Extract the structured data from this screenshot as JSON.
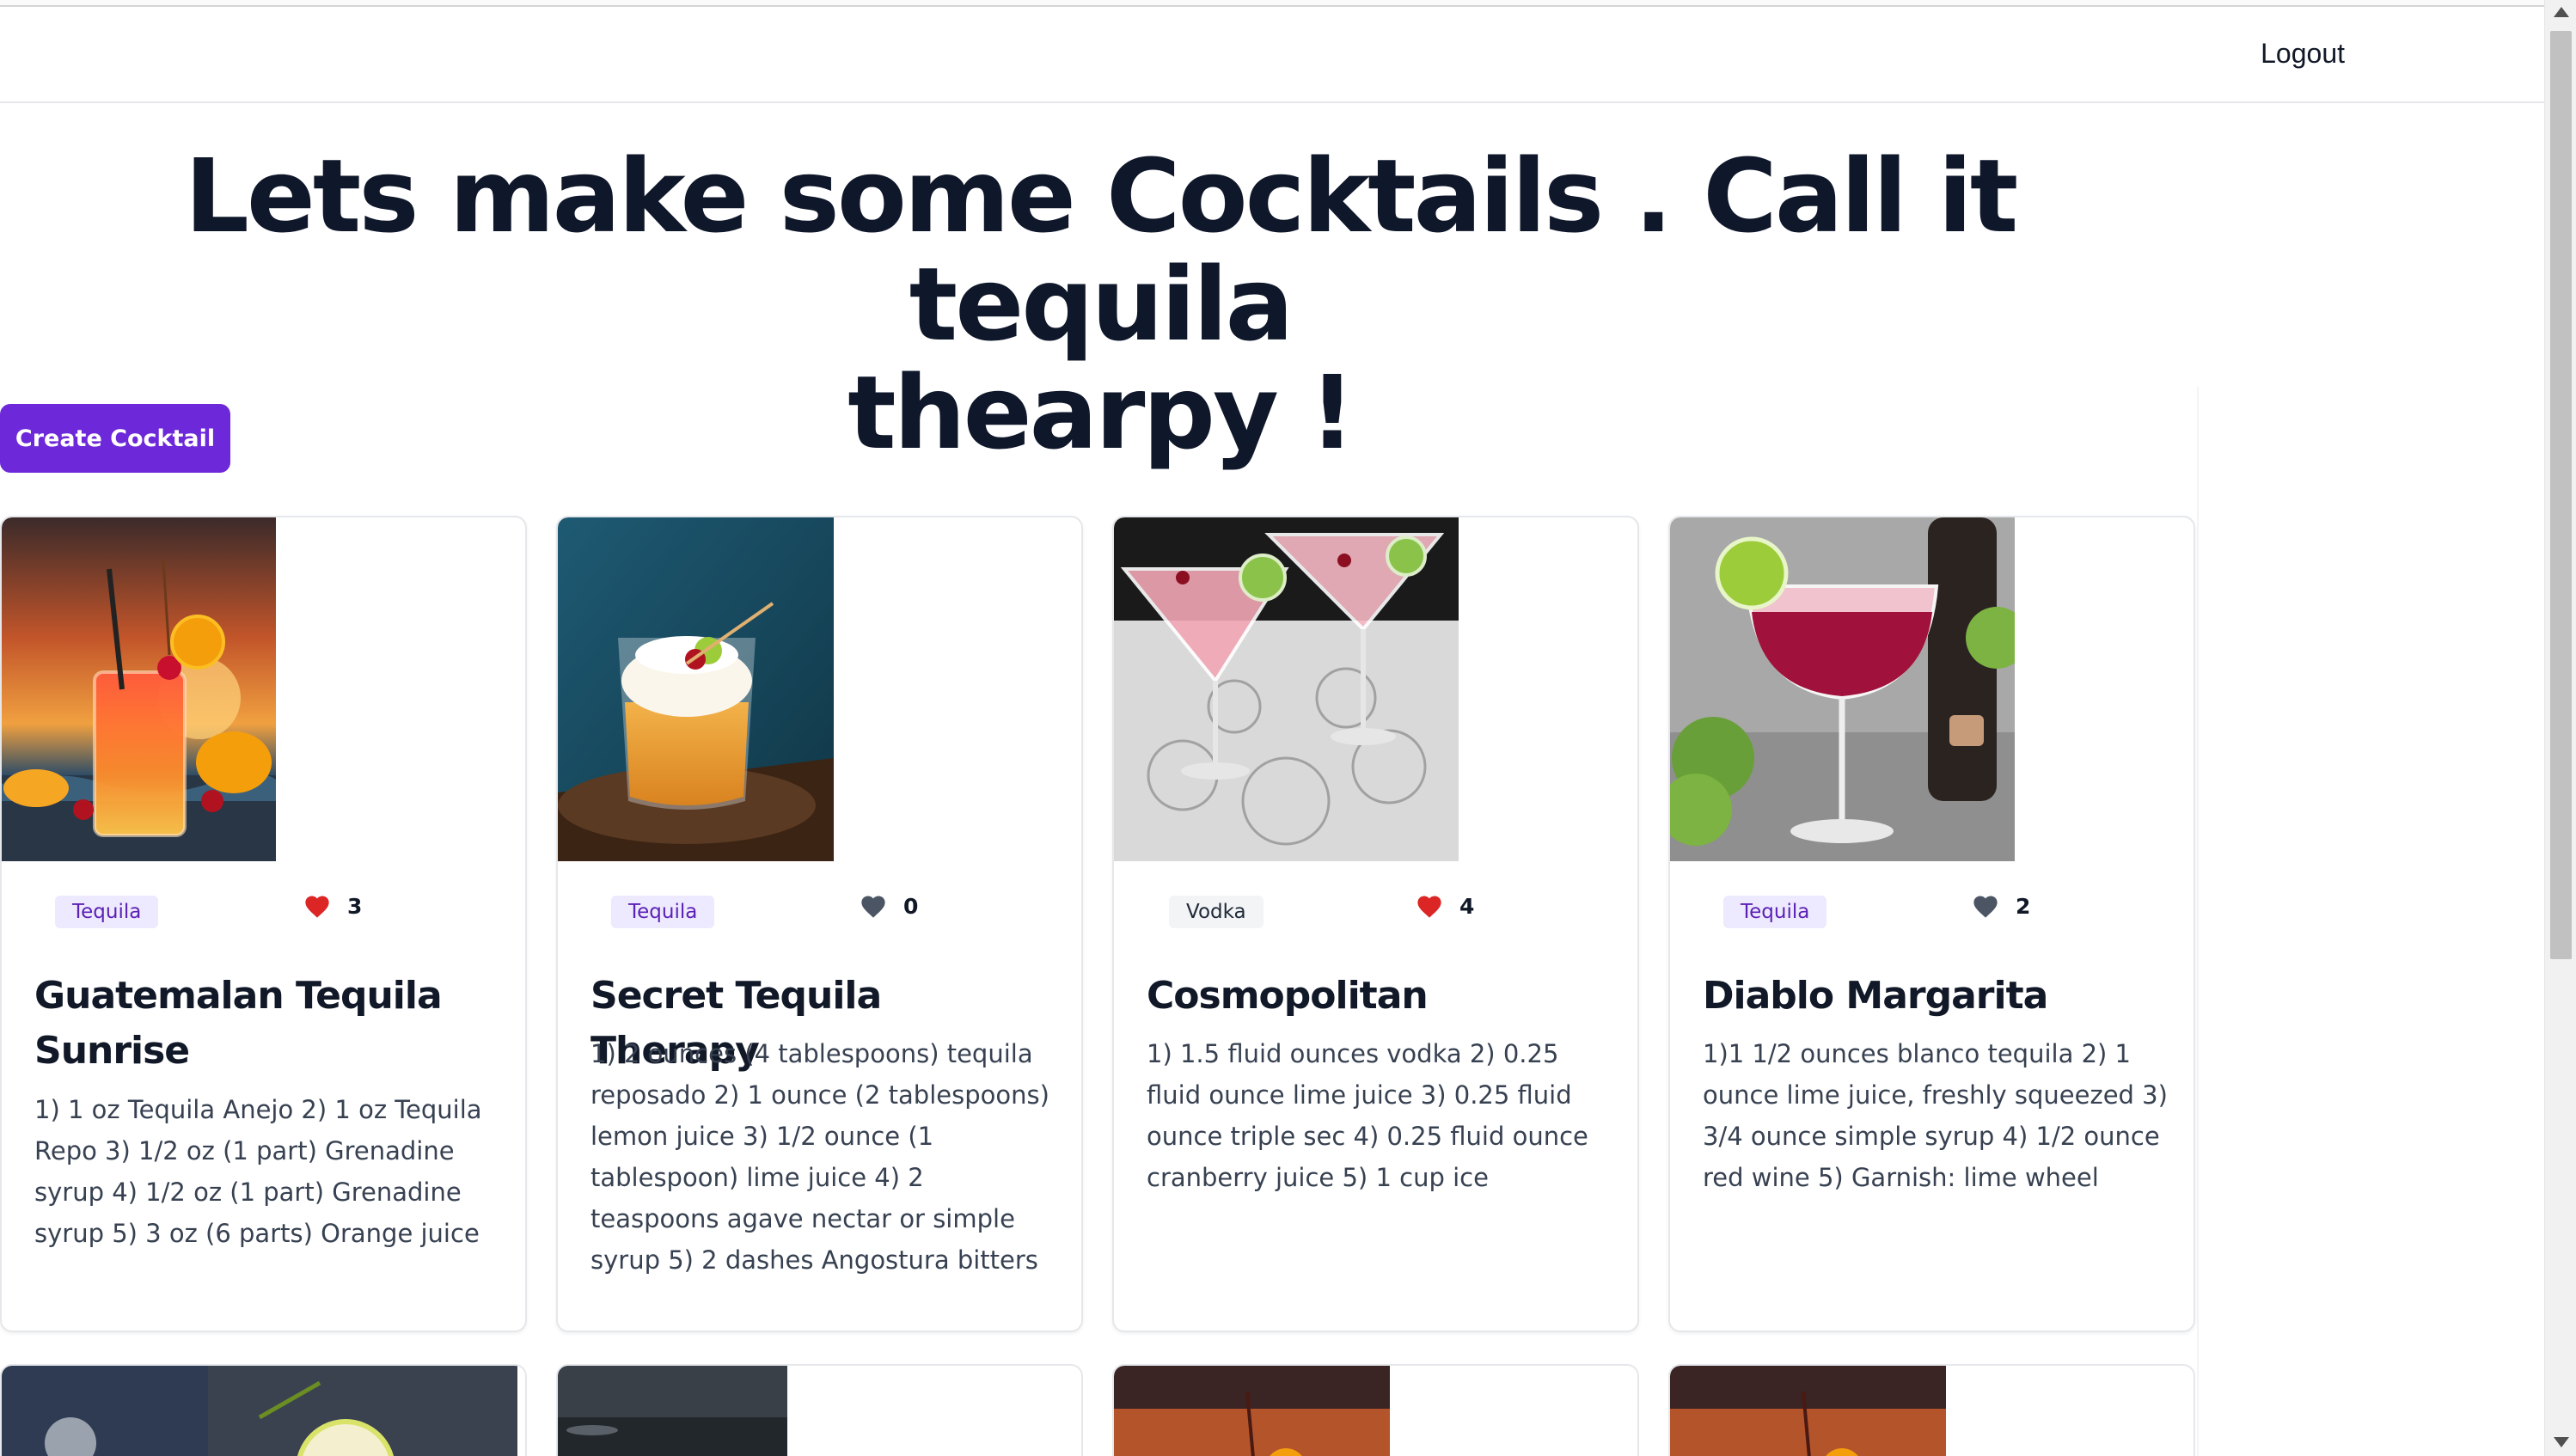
{
  "nav": {
    "logout_label": "Logout"
  },
  "hero": {
    "line1": "Lets make some Cocktails . Call it tequila",
    "line2": "thearpy !"
  },
  "actions": {
    "create_label": "Create Cocktail"
  },
  "colors": {
    "accent": "#6d28d9",
    "tag_purple_bg": "#ede9fe",
    "tag_purple_text": "#5b21b6",
    "tag_gray_bg": "#f3f4f6",
    "tag_gray_text": "#1f2937",
    "heart_liked": "#dc2626",
    "heart_unliked": "#4b5563"
  },
  "cocktails": [
    {
      "title": "Guatemalan Tequila Sunrise",
      "category": "Tequila",
      "likes": "3",
      "liked": true,
      "image": "tequila-sunrise-photo",
      "description": "1) 1 oz Tequila Anejo 2) 1 oz Tequila Repo 3) 1/2 oz (1 part) Grenadine syrup 4) 1/2 oz (1 part) Grenadine syrup 5) 3 oz (6 parts) Orange juice"
    },
    {
      "title": "Secret Tequila Therapy",
      "category": "Tequila",
      "likes": "0",
      "liked": false,
      "image": "whiskey-sour-photo",
      "description": "1) 2 ounces (4 tablespoons) tequila reposado 2) 1 ounce (2 tablespoons) lemon juice 3) 1/2 ounce (1 tablespoon) lime juice 4) 2 teaspoons agave nectar or simple syrup 5) 2 dashes Angostura bitters"
    },
    {
      "title": "Cosmopolitan",
      "category": "Vodka",
      "likes": "4",
      "liked": true,
      "image": "cosmopolitan-photo",
      "description": "1) 1.5 fluid ounces vodka 2) 0.25 fluid ounce lime juice 3) 0.25 fluid ounce triple sec 4) 0.25 fluid ounce cranberry juice 5) 1 cup ice"
    },
    {
      "title": "Diablo Margarita",
      "category": "Tequila",
      "likes": "2",
      "liked": false,
      "image": "diablo-margarita-photo",
      "description": "1)1 1/2 ounces blanco tequila 2) 1 ounce lime juice, freshly squeezed 3) 3/4 ounce simple syrup 4) 1/2 ounce red wine 5) Garnish: lime wheel"
    }
  ]
}
